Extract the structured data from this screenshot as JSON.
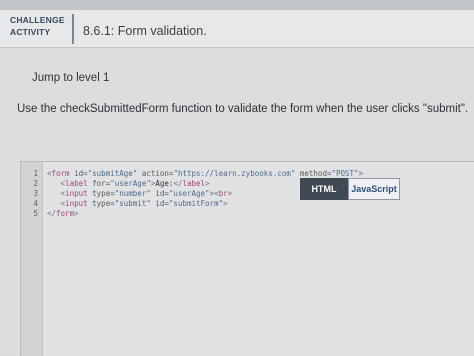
{
  "header": {
    "badge_line1": "CHALLENGE",
    "badge_line2": "ACTIVITY",
    "title": "8.6.1: Form validation."
  },
  "main": {
    "jump_label": "Jump to level 1",
    "instructions": "Use the checkSubmittedForm function to validate the form when the user clicks \"submit\"."
  },
  "tabs": {
    "html_label": "HTML",
    "js_label": "JavaScript"
  },
  "editor": {
    "line_numbers": [
      "1",
      "2",
      "3",
      "4",
      "5"
    ],
    "lines": [
      [
        {
          "cls": "p",
          "text": "<"
        },
        {
          "cls": "t",
          "text": "form"
        },
        {
          "cls": "a",
          "text": " id="
        },
        {
          "cls": "s",
          "text": "\"submitAge\""
        },
        {
          "cls": "a",
          "text": " action="
        },
        {
          "cls": "s",
          "text": "\"https://learn.zybooks.com\""
        },
        {
          "cls": "a",
          "text": " method="
        },
        {
          "cls": "s",
          "text": "\"POST\""
        },
        {
          "cls": "p",
          "text": ">"
        }
      ],
      [
        {
          "cls": "x",
          "text": "   "
        },
        {
          "cls": "p",
          "text": "<"
        },
        {
          "cls": "t",
          "text": "label"
        },
        {
          "cls": "a",
          "text": " for="
        },
        {
          "cls": "s",
          "text": "\"userAge\""
        },
        {
          "cls": "p",
          "text": ">"
        },
        {
          "cls": "x",
          "text": "Age:"
        },
        {
          "cls": "p",
          "text": "</"
        },
        {
          "cls": "t",
          "text": "label"
        },
        {
          "cls": "p",
          "text": ">"
        }
      ],
      [
        {
          "cls": "x",
          "text": "   "
        },
        {
          "cls": "p",
          "text": "<"
        },
        {
          "cls": "t",
          "text": "input"
        },
        {
          "cls": "a",
          "text": " type="
        },
        {
          "cls": "s",
          "text": "\"number\""
        },
        {
          "cls": "a",
          "text": " id="
        },
        {
          "cls": "s",
          "text": "\"userAge\""
        },
        {
          "cls": "p",
          "text": "><"
        },
        {
          "cls": "t",
          "text": "br"
        },
        {
          "cls": "p",
          "text": ">"
        }
      ],
      [
        {
          "cls": "x",
          "text": "   "
        },
        {
          "cls": "p",
          "text": "<"
        },
        {
          "cls": "t",
          "text": "input"
        },
        {
          "cls": "a",
          "text": " type="
        },
        {
          "cls": "s",
          "text": "\"submit\""
        },
        {
          "cls": "a",
          "text": " id="
        },
        {
          "cls": "s",
          "text": "\"submitForm\""
        },
        {
          "cls": "p",
          "text": ">"
        }
      ],
      [
        {
          "cls": "p",
          "text": "</"
        },
        {
          "cls": "t",
          "text": "form"
        },
        {
          "cls": "p",
          "text": ">"
        }
      ]
    ]
  },
  "colors": {
    "tab_active_bg": "#3f4a55",
    "badge_text": "#34495e",
    "tag_color": "#a6437d",
    "string_color": "#4d6a8e"
  }
}
